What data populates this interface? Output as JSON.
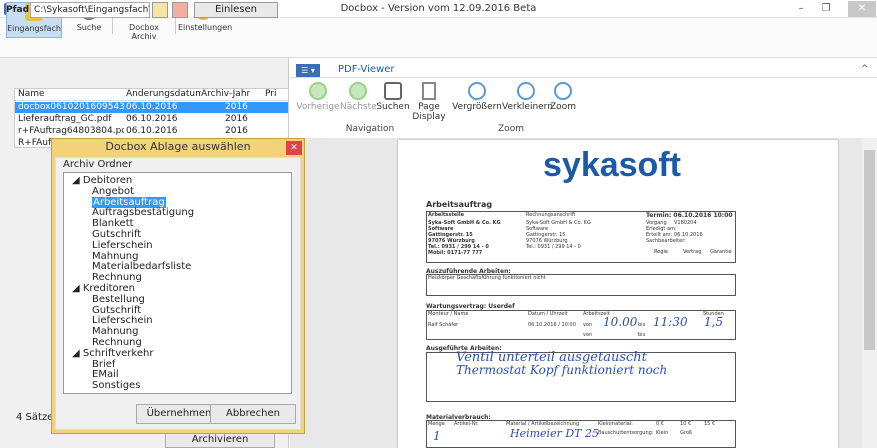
{
  "window": {
    "title": "Docbox - Version vom 12.09.2016 Beta",
    "min": "–",
    "max": "❐",
    "close": "✕"
  },
  "ribbon": {
    "items": [
      "Eingangsfach",
      "Suche",
      "Docbox Archiv",
      "Einstellungen"
    ]
  },
  "left": {
    "path_label": "Pfad",
    "path_value": "C:\\Sykasoft\\Eingangsfach\\",
    "einlesen": "Einlesen",
    "columns": [
      "Name",
      "Änderungsdatum",
      "Archiv-Jahr",
      "Pri"
    ],
    "rows": [
      {
        "name": "docbox06102016095439.pdf",
        "date": "06.10.2016",
        "year": "2016"
      },
      {
        "name": "Lieferauftrag_GC.pdf",
        "date": "06.10.2016",
        "year": "2016"
      },
      {
        "name": "r+FAuftrag64803804.pdf",
        "date": "06.10.2016",
        "year": "2016"
      },
      {
        "name": "R+FAuft",
        "date": "",
        "year": ""
      }
    ],
    "status": "4 Sätze",
    "archivieren": "Archivieren"
  },
  "viewer": {
    "tab": "PDF-Viewer",
    "tab_icon": "☰ ▾",
    "collapse": "^",
    "buttons": [
      "Vorherige",
      "Nächste",
      "Suchen",
      "Page Display",
      "Vergrößern",
      "Verkleinern",
      "Zoom"
    ],
    "groups": [
      "Navigation",
      "Zoom"
    ]
  },
  "document": {
    "logo": "sykasoft",
    "title": "Arbeitsauftrag",
    "termin": "Termin: 06.10.2016 10:00",
    "company": "Syka-Soft GmbH & Co. KG",
    "company2": "Software",
    "street": "Gattingerstr. 15",
    "city": "97076 Würzburg",
    "tel": "Tel.: 0931 / 299 14 - 0",
    "mobil": "Mobil: 0171-77 777",
    "label_arbeitsstelle": "Arbeitsstelle",
    "label_rechnung": "Rechnungsanschrift",
    "vorgang_label": "Vorgang",
    "vorgang": "V160204",
    "erledigt": "Erledigt am:",
    "erteilt_label": "Erteilt am:",
    "erteilt": "06.10.2016",
    "sachbearbeiter": "Sachbearbeiter:",
    "regie": "Regie",
    "vertrag": "Vertrag",
    "garantie": "Garantie",
    "auszufuehrende": "Auszuführende Arbeiten:",
    "auszufuehrende_text": "Heizkörper Geschäftsführung funktioniert nicht",
    "wartung": "Wartungsvertrag: Userdef",
    "col_monteur": "Monteur / Name",
    "col_datum": "Datum / Uhrzeit",
    "col_arbeitszeit": "Arbeitszeit",
    "col_stunden": "Stunden",
    "monteur": "Ralf Schäfer",
    "datum": "06.10.2016 / 10:00",
    "von": "von",
    "bis": "bis",
    "hw_von": "10.00",
    "hw_bis": "11:30",
    "hw_std": "1,5",
    "ausgefuehrte": "Ausgeführte Arbeiten:",
    "hw_line1": "Ventil unterteil ausgetauscht",
    "hw_line2": "Thermostat Kopf funktioniert noch",
    "material": "Materialverbrauch:",
    "col_menge": "Menge",
    "col_artikel": "Artikel-Nr.",
    "col_bez": "Material / Artikelbezeichnung",
    "kleinmaterial": "Kleinmaterial:",
    "bauschutt": "Bauschuttentsorgung:",
    "hw_menge": "1",
    "hw_mat": "Heimeier DT 25",
    "opt1": "0 €",
    "opt2": "10 €",
    "opt3": "15 €",
    "opt4": "Klein",
    "opt5": "Groß"
  },
  "dialog": {
    "title": "Docbox Ablage auswählen",
    "close": "✕",
    "group_label": "Archiv Ordner",
    "tree": [
      {
        "label": "◢ Debitoren",
        "level": 0
      },
      {
        "label": "Angebot",
        "level": 1
      },
      {
        "label": "Arbeitsauftrag",
        "level": 1,
        "selected": true
      },
      {
        "label": "Auftragsbestätigung",
        "level": 1
      },
      {
        "label": "Blankett",
        "level": 1
      },
      {
        "label": "Gutschrift",
        "level": 1
      },
      {
        "label": "Lieferschein",
        "level": 1
      },
      {
        "label": "Mahnung",
        "level": 1
      },
      {
        "label": "Materialbedarfsliste",
        "level": 1
      },
      {
        "label": "Rechnung",
        "level": 1
      },
      {
        "label": "◢ Kreditoren",
        "level": 0
      },
      {
        "label": "Bestellung",
        "level": 1
      },
      {
        "label": "Gutschrift",
        "level": 1
      },
      {
        "label": "Lieferschein",
        "level": 1
      },
      {
        "label": "Mahnung",
        "level": 1
      },
      {
        "label": "Rechnung",
        "level": 1
      },
      {
        "label": "◢ Schriftverkehr",
        "level": 0
      },
      {
        "label": "Brief",
        "level": 1
      },
      {
        "label": "EMail",
        "level": 1
      },
      {
        "label": "Sonstiges",
        "level": 1
      }
    ],
    "ok": "Übernehmen",
    "cancel": "Abbrechen"
  }
}
